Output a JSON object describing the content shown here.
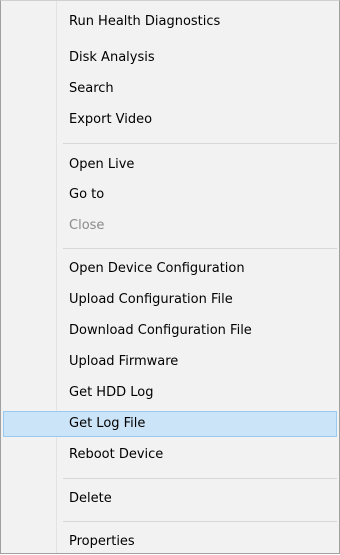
{
  "menu": {
    "items": [
      {
        "label": "Run Health Diagnostics",
        "enabled": true
      },
      {
        "label": "Disk Analysis",
        "enabled": true
      },
      {
        "label": "Search",
        "enabled": true
      },
      {
        "label": "Export Video",
        "enabled": true
      },
      {
        "label": "Open Live",
        "enabled": true
      },
      {
        "label": "Go to",
        "enabled": true
      },
      {
        "label": "Close",
        "enabled": false
      },
      {
        "label": "Open Device Configuration",
        "enabled": true
      },
      {
        "label": "Upload Configuration File",
        "enabled": true
      },
      {
        "label": "Download Configuration File",
        "enabled": true
      },
      {
        "label": "Upload Firmware",
        "enabled": true
      },
      {
        "label": "Get HDD Log",
        "enabled": true
      },
      {
        "label": "Get Log File",
        "enabled": true,
        "highlighted": true
      },
      {
        "label": "Reboot Device",
        "enabled": true
      },
      {
        "label": "Delete",
        "enabled": true
      },
      {
        "label": "Properties",
        "enabled": true
      }
    ],
    "colors": {
      "highlight_fill": "#cce4f7",
      "highlight_border": "#99c9ef",
      "disabled_text": "#8a8a8a",
      "background": "#f2f2f2"
    }
  }
}
